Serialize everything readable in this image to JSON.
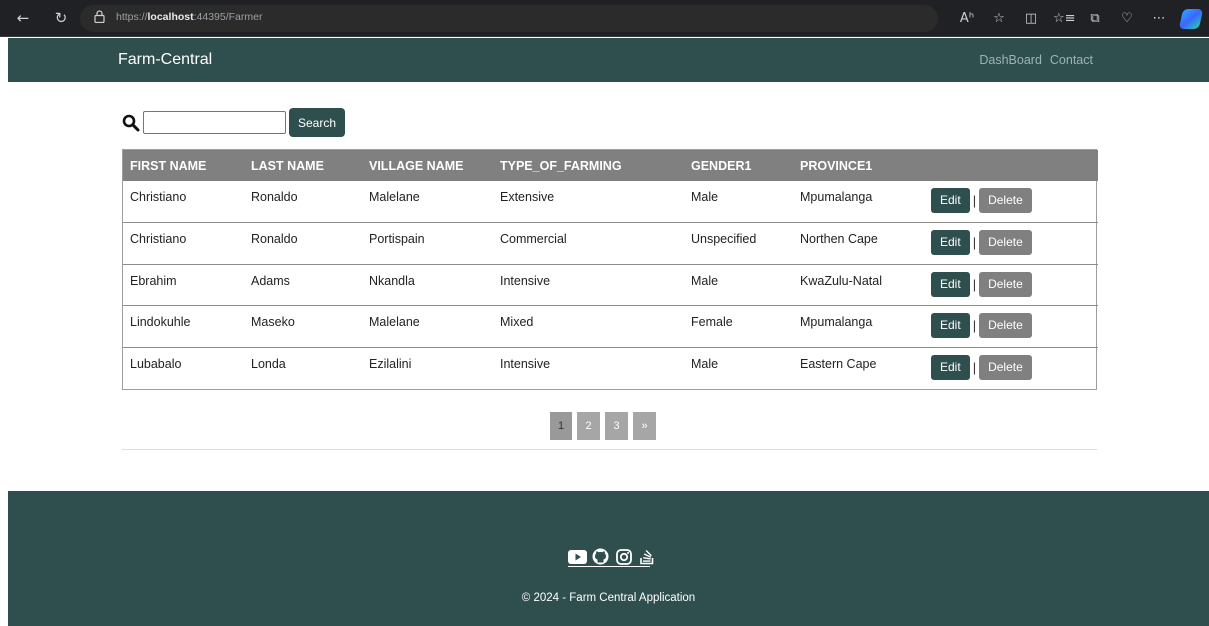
{
  "browser": {
    "url_prefix": "https://",
    "url_host": "localhost",
    "url_rest": ":44395/Farmer",
    "reader_label": "Aʰ"
  },
  "navbar": {
    "brand": "Farm-Central",
    "links": [
      "DashBoard",
      "Contact"
    ]
  },
  "search": {
    "value": "",
    "button_label": "Search"
  },
  "table": {
    "headers": [
      "FIRST NAME",
      "LAST NAME",
      "VILLAGE NAME",
      "TYPE_OF_FARMING",
      "GENDER1",
      "PROVINCE1",
      ""
    ],
    "rows": [
      [
        "Christiano",
        "Ronaldo",
        "Malelane",
        "Extensive",
        "Male",
        "Mpumalanga"
      ],
      [
        "Christiano",
        "Ronaldo",
        "Portispain",
        "Commercial",
        "Unspecified",
        "Northen Cape"
      ],
      [
        "Ebrahim",
        "Adams",
        "Nkandla",
        "Intensive",
        "Male",
        "KwaZulu-Natal"
      ],
      [
        "Lindokuhle",
        "Maseko",
        "Malelane",
        "Mixed",
        "Female",
        "Mpumalanga"
      ],
      [
        "Lubabalo",
        "Londa",
        "Ezilalini",
        "Intensive",
        "Male",
        "Eastern Cape"
      ]
    ],
    "edit_label": "Edit",
    "separator": "|",
    "delete_label": "Delete"
  },
  "pagination": {
    "pages": [
      "1",
      "2",
      "3",
      "»"
    ]
  },
  "footer": {
    "icons": [
      "youtube-icon",
      "github-icon",
      "instagram-icon",
      "stackoverflow-icon"
    ],
    "copyright": "© 2024 - Farm Central Application"
  },
  "colors": {
    "primary": "#2f4f4f",
    "header_bg": "#808080",
    "delete_bg": "#808080"
  }
}
